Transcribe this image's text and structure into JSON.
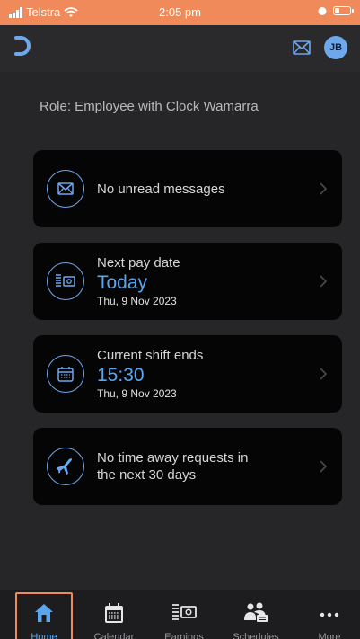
{
  "status_bar": {
    "carrier": "Telstra",
    "time": "2:05 pm"
  },
  "header": {
    "logo": "logo-mark",
    "avatar_initials": "JB"
  },
  "role_text": "Role: Employee with Clock Wamarra",
  "cards": {
    "messages": {
      "text": "No unread messages",
      "icon": "mail-icon"
    },
    "pay": {
      "title": "Next pay date",
      "value": "Today",
      "date": "Thu, 9 Nov 2023",
      "icon": "money-icon"
    },
    "shift": {
      "title": "Current shift ends",
      "value": "15:30",
      "date": "Thu, 9 Nov 2023",
      "icon": "calendar-icon"
    },
    "time_away": {
      "line1": "No time away requests in",
      "line2": "the next 30 days",
      "icon": "plane-icon"
    }
  },
  "tabs": [
    {
      "label": "Home",
      "icon": "home-icon",
      "active": true
    },
    {
      "label": "Calendar",
      "icon": "calendar-icon"
    },
    {
      "label": "Earnings",
      "icon": "money-icon"
    },
    {
      "label": "Schedules",
      "icon": "people-icon"
    },
    {
      "label": "More",
      "icon": "more-icon"
    }
  ],
  "colors": {
    "accent": "#5aa6ee",
    "status_bar": "#f08a5b",
    "card_bg": "#050505",
    "background": "#262628"
  }
}
